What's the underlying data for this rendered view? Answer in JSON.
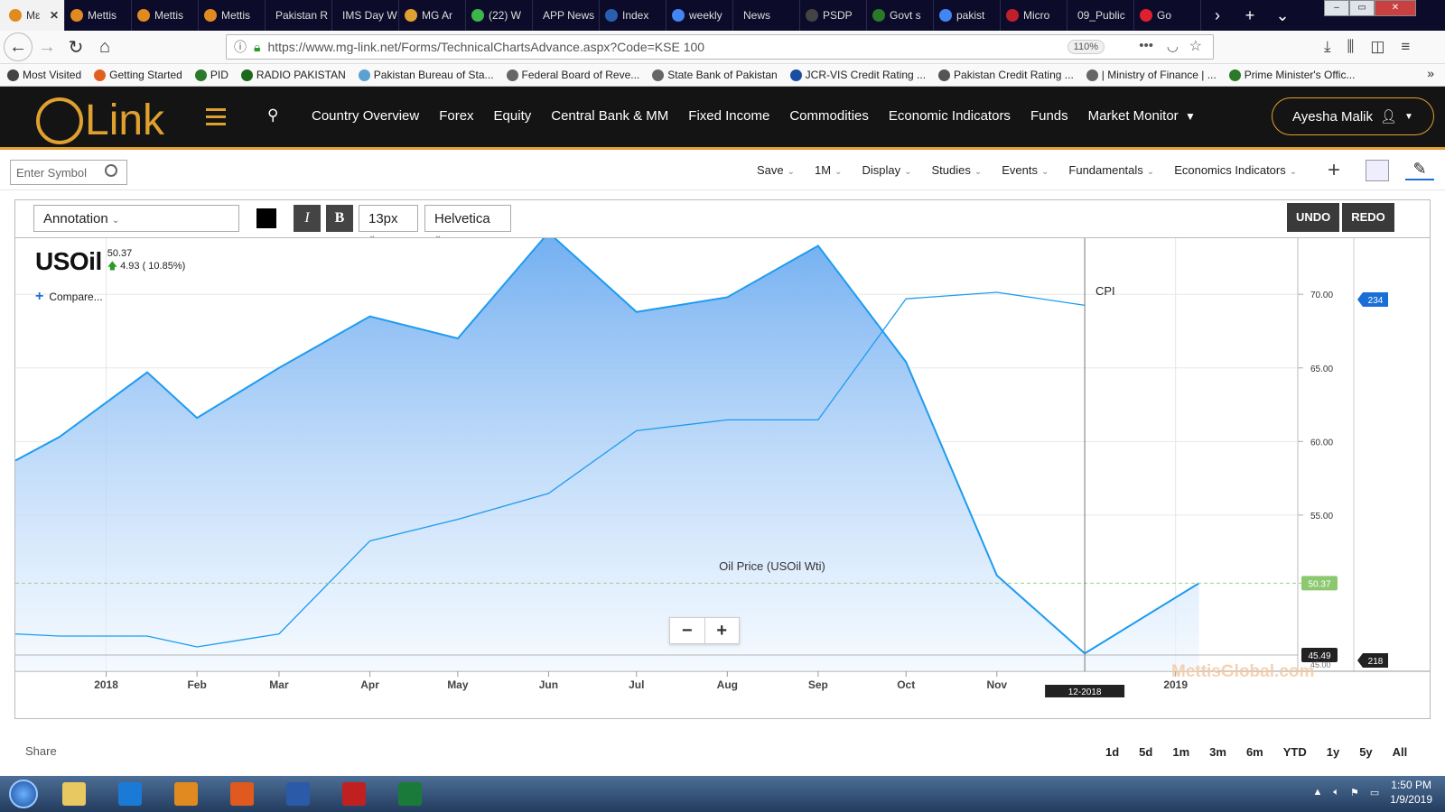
{
  "browser": {
    "tabs": [
      {
        "label": "Mε",
        "color": "#e08a20",
        "active": true
      },
      {
        "label": "Mettis",
        "color": "#e08a20"
      },
      {
        "label": "Mettis",
        "color": "#e08a20"
      },
      {
        "label": "Mettis",
        "color": "#e08a20"
      },
      {
        "label": "Pakistan R",
        "color": ""
      },
      {
        "label": "IMS Day W",
        "color": ""
      },
      {
        "label": "MG Ar",
        "color": "#e0a030"
      },
      {
        "label": "(22) W",
        "color": "#3cb54a"
      },
      {
        "label": "APP News",
        "color": ""
      },
      {
        "label": "Index",
        "color": "#2a5fb0"
      },
      {
        "label": "weekly",
        "color": "#4285f4"
      },
      {
        "label": "News",
        "color": ""
      },
      {
        "label": "PSDP",
        "color": "#444"
      },
      {
        "label": "Govt s",
        "color": "#2a7a2a"
      },
      {
        "label": "pakist",
        "color": "#4285f4"
      },
      {
        "label": "Micro",
        "color": "#c0202a"
      },
      {
        "label": "09_Public",
        "color": ""
      },
      {
        "label": "Go",
        "color": "#e02030"
      }
    ],
    "url": "https://www.mg-link.net/Forms/TechnicalChartsAdvance.aspx?Code=KSE 100",
    "zoom": "110%",
    "bookmarks": [
      {
        "label": "Most Visited",
        "color": "#444"
      },
      {
        "label": "Getting Started",
        "color": "#e06020"
      },
      {
        "label": "PID",
        "color": "#2a7a2a"
      },
      {
        "label": "RADIO PAKISTAN",
        "color": "#1a6a1a"
      },
      {
        "label": "Pakistan Bureau of Sta...",
        "color": "#5aa0d0"
      },
      {
        "label": "Federal Board of Reve...",
        "color": "#666"
      },
      {
        "label": "State Bank of Pakistan",
        "color": "#666"
      },
      {
        "label": "JCR-VIS Credit Rating ...",
        "color": "#1a4ea0"
      },
      {
        "label": "Pakistan Credit Rating ...",
        "color": "#555"
      },
      {
        "label": "| Ministry of Finance | ...",
        "color": "#666"
      },
      {
        "label": "Prime Minister's Offic...",
        "color": "#2a7a2a"
      }
    ]
  },
  "site": {
    "logo_text": "Link",
    "nav": [
      "Country Overview",
      "Forex",
      "Equity",
      "Central Bank & MM",
      "Fixed Income",
      "Commodities",
      "Economic Indicators",
      "Funds",
      "Market Monitor"
    ],
    "user": "Ayesha Malik"
  },
  "chart_toolbar": {
    "symbol_placeholder": "Enter Symbol",
    "tools": [
      "Save",
      "1M",
      "Display",
      "Studies",
      "Events",
      "Fundamentals",
      "Economics Indicators"
    ]
  },
  "annotation_bar": {
    "select": "Annotation",
    "italic": "I",
    "bold": "B",
    "font_size": "13px",
    "font_family": "Helvetica",
    "undo": "UNDO",
    "redo": "REDO"
  },
  "symbol": {
    "name": "USOil",
    "price": "50.37",
    "change": "4.93 ( 10.85%)",
    "compare": "Compare..."
  },
  "chart_data": {
    "type": "area",
    "x_ticks": [
      "2018",
      "Feb",
      "Mar",
      "Apr",
      "May",
      "Jun",
      "Jul",
      "Aug",
      "Sep",
      "Oct",
      "Nov",
      "2019"
    ],
    "y_ticks": [
      "70.00",
      "65.00",
      "60.00",
      "55.00"
    ],
    "ylim": [
      45,
      75
    ],
    "series": [
      {
        "name": "Oil Price (USOil Wti)",
        "axis": "left",
        "color": "#1e9bf0",
        "x": [
          "2017-12-01",
          "2017-12-16",
          "2018-01-15",
          "2018-02-01",
          "2018-03-01",
          "2018-04-01",
          "2018-05-01",
          "2018-06-01",
          "2018-07-01",
          "2018-08-01",
          "2018-09-01",
          "2018-10-01",
          "2018-11-01",
          "2018-12-01",
          "2019-01-09"
        ],
        "values": [
          58.7,
          60.3,
          64.7,
          61.6,
          65.0,
          68.5,
          67.0,
          74.2,
          68.8,
          69.8,
          73.3,
          65.4,
          50.9,
          45.6,
          50.37
        ]
      },
      {
        "name": "CPI",
        "axis": "right",
        "color": "#1e9bf0",
        "x": [
          "2017-12-01",
          "2017-12-16",
          "2018-01-15",
          "2018-02-01",
          "2018-03-01",
          "2018-04-01",
          "2018-05-01",
          "2018-06-01",
          "2018-07-01",
          "2018-08-01",
          "2018-09-01",
          "2018-10-01",
          "2018-11-01",
          "2018-12-01"
        ],
        "values": [
          218.3,
          218.2,
          218.2,
          217.7,
          218.3,
          222.6,
          223.6,
          224.8,
          227.7,
          228.2,
          228.2,
          233.8,
          234.1,
          233.5
        ]
      }
    ],
    "last_label": "50.37",
    "crosshair_value": "45.49",
    "crosshair_date": "12-2018",
    "cpi_top_label": "234",
    "cpi_bottom_label": "218",
    "bottom_tick": "45.00",
    "watermark": "MettisGlobal.com"
  },
  "ranges": [
    "1d",
    "5d",
    "1m",
    "3m",
    "6m",
    "YTD",
    "1y",
    "5y",
    "All"
  ],
  "share": "Share",
  "taskbar": {
    "apps": [
      "#e8c860",
      "#1a7ad6",
      "#e08a20",
      "#e05a20",
      "#2a5aa8",
      "#c02020",
      "#1a7a3a"
    ],
    "time": "1:50 PM",
    "date": "1/9/2019"
  }
}
